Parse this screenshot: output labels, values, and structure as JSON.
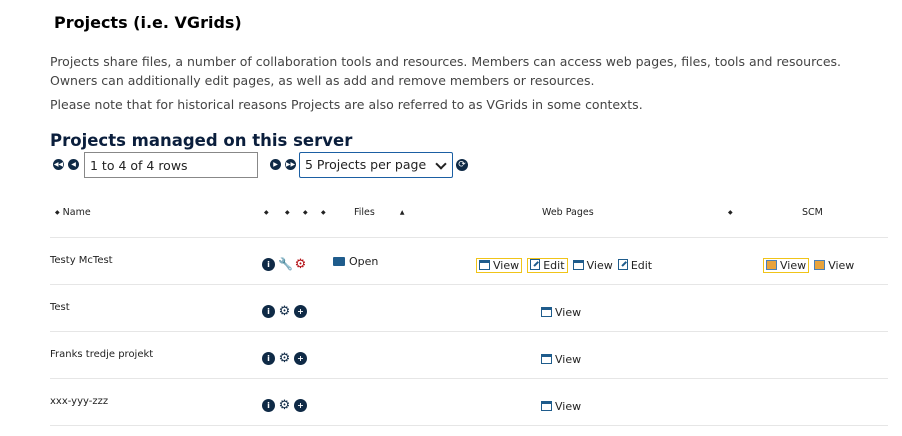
{
  "heading": "Projects (i.e. VGrids)",
  "intro": "Projects share files, a number of collaboration tools and resources. Members can access web pages, files, tools and resources. Owners can additionally edit pages, as well as add and remove members or resources.",
  "note": "Please note that for historical reasons Projects are also referred to as VGrids in some contexts.",
  "managed_heading": "Projects managed on this server",
  "pager": {
    "rows_text": "1 to 4 of 4 rows",
    "per_page": "5 Projects per page"
  },
  "columns": {
    "name": "Name",
    "files": "Files",
    "web_pages": "Web Pages",
    "scm": "SCM"
  },
  "links": {
    "open": "Open",
    "view": "View",
    "edit": "Edit"
  },
  "rows": [
    {
      "name": "Testy McTest"
    },
    {
      "name": "Test"
    },
    {
      "name": "Franks tredje projekt"
    },
    {
      "name": "xxx-yyy-zzz"
    }
  ],
  "icons": [
    "first-page-icon",
    "prev-page-icon",
    "next-page-icon",
    "last-page-icon",
    "refresh-icon",
    "info-icon",
    "wrench-icon",
    "gear-icon",
    "plus-icon",
    "folder-icon",
    "document-icon",
    "edit-icon",
    "scm-icon"
  ],
  "colors": {
    "accent": "#0f2a46",
    "highlight": "#f0c419",
    "admin_gear": "#b40f14"
  }
}
